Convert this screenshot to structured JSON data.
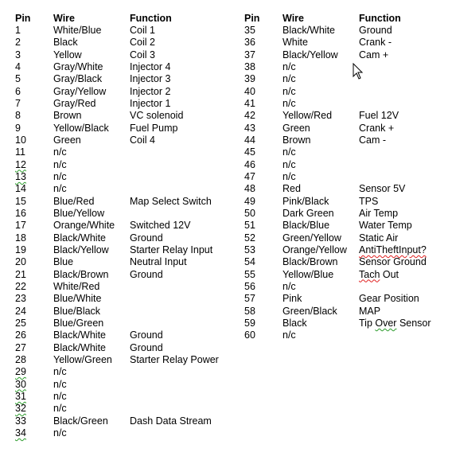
{
  "headers": {
    "pin": "Pin",
    "wire": "Wire",
    "function": "Function"
  },
  "left_table": [
    {
      "pin": "1",
      "wire": "White/Blue",
      "function": "Coil 1"
    },
    {
      "pin": "2",
      "wire": "Black",
      "function": "Coil 2"
    },
    {
      "pin": "3",
      "wire": "Yellow",
      "function": "Coil 3"
    },
    {
      "pin": "4",
      "wire": "Gray/White",
      "function": "Injector 4"
    },
    {
      "pin": "5",
      "wire": "Gray/Black",
      "function": "Injector 3"
    },
    {
      "pin": "6",
      "wire": "Gray/Yellow",
      "function": "Injector 2"
    },
    {
      "pin": "7",
      "wire": "Gray/Red",
      "function": "Injector 1"
    },
    {
      "pin": "8",
      "wire": "Brown",
      "function": "VC solenoid"
    },
    {
      "pin": "9",
      "wire": "Yellow/Black",
      "function": "Fuel Pump"
    },
    {
      "pin": "10",
      "wire": "Green",
      "function": "Coil 4"
    },
    {
      "pin": "11",
      "wire": "n/c",
      "function": ""
    },
    {
      "pin": "12",
      "wire": "n/c",
      "function": "",
      "pin_spell": "green"
    },
    {
      "pin": "13",
      "wire": "n/c",
      "function": "",
      "pin_spell": "green"
    },
    {
      "pin": "14",
      "wire": "n/c",
      "function": ""
    },
    {
      "pin": "15",
      "wire": "Blue/Red",
      "function": "Map Select Switch"
    },
    {
      "pin": "16",
      "wire": "Blue/Yellow",
      "function": ""
    },
    {
      "pin": "17",
      "wire": "Orange/White",
      "function": "Switched 12V"
    },
    {
      "pin": "18",
      "wire": "Black/White",
      "function": "Ground"
    },
    {
      "pin": "19",
      "wire": "Black/Yellow",
      "function": "Starter Relay Input"
    },
    {
      "pin": "20",
      "wire": "Blue",
      "function": "Neutral Input"
    },
    {
      "pin": "21",
      "wire": "Black/Brown",
      "function": "Ground"
    },
    {
      "pin": "22",
      "wire": "White/Red",
      "function": ""
    },
    {
      "pin": "23",
      "wire": "Blue/White",
      "function": ""
    },
    {
      "pin": "24",
      "wire": "Blue/Black",
      "function": ""
    },
    {
      "pin": "25",
      "wire": "Blue/Green",
      "function": ""
    },
    {
      "pin": "26",
      "wire": "Black/White",
      "function": "Ground"
    },
    {
      "pin": "27",
      "wire": "Black/White",
      "function": "Ground"
    },
    {
      "pin": "28",
      "wire": "Yellow/Green",
      "function": "Starter Relay Power"
    },
    {
      "pin": "29",
      "wire": "n/c",
      "function": "",
      "pin_spell": "green"
    },
    {
      "pin": "30",
      "wire": "n/c",
      "function": "",
      "pin_spell": "green"
    },
    {
      "pin": "31",
      "wire": "n/c",
      "function": "",
      "pin_spell": "green"
    },
    {
      "pin": "32",
      "wire": "n/c",
      "function": "",
      "pin_spell": "green"
    },
    {
      "pin": "33",
      "wire": "Black/Green",
      "function": "Dash Data Stream"
    },
    {
      "pin": "34",
      "wire": "n/c",
      "function": "",
      "pin_spell": "green"
    }
  ],
  "right_table": [
    {
      "pin": "35",
      "wire": "Black/White",
      "function": "Ground"
    },
    {
      "pin": "36",
      "wire": "White",
      "function": "Crank -"
    },
    {
      "pin": "37",
      "wire": "Black/Yellow",
      "function": "Cam +"
    },
    {
      "pin": "38",
      "wire": "n/c",
      "function": ""
    },
    {
      "pin": "39",
      "wire": "n/c",
      "function": ""
    },
    {
      "pin": "40",
      "wire": "n/c",
      "function": ""
    },
    {
      "pin": "41",
      "wire": "n/c",
      "function": ""
    },
    {
      "pin": "42",
      "wire": "Yellow/Red",
      "function": "Fuel 12V"
    },
    {
      "pin": "43",
      "wire": "Green",
      "function": "Crank +"
    },
    {
      "pin": "44",
      "wire": "Brown",
      "function": "Cam -"
    },
    {
      "pin": "45",
      "wire": "n/c",
      "function": ""
    },
    {
      "pin": "46",
      "wire": "n/c",
      "function": ""
    },
    {
      "pin": "47",
      "wire": "n/c",
      "function": ""
    },
    {
      "pin": "48",
      "wire": "Red",
      "function": "Sensor 5V"
    },
    {
      "pin": "49",
      "wire": "Pink/Black",
      "function": "TPS"
    },
    {
      "pin": "50",
      "wire": "Dark Green",
      "function": "Air Temp"
    },
    {
      "pin": "51",
      "wire": "Black/Blue",
      "function": "Water Temp"
    },
    {
      "pin": "52",
      "wire": "Green/Yellow",
      "function": "Static Air"
    },
    {
      "pin": "53",
      "wire": "Orange/Yellow",
      "function": "AntiTheftInput?",
      "func_spell": "red"
    },
    {
      "pin": "54",
      "wire": "Black/Brown",
      "function": "Sensor Ground"
    },
    {
      "pin": "55",
      "wire": "Yellow/Blue",
      "function": "Tach Out",
      "func_spell_word": "Tach",
      "func_spell_color": "red"
    },
    {
      "pin": "56",
      "wire": "n/c",
      "function": ""
    },
    {
      "pin": "57",
      "wire": "Pink",
      "function": "Gear Position"
    },
    {
      "pin": "58",
      "wire": "Green/Black",
      "function": "MAP"
    },
    {
      "pin": "59",
      "wire": "Black",
      "function": "Tip Over Sensor",
      "func_spell_word": "Over",
      "func_spell_color": "green"
    },
    {
      "pin": "60",
      "wire": "n/c",
      "function": ""
    }
  ],
  "cursor_icon": "arrow-pointer-icon"
}
